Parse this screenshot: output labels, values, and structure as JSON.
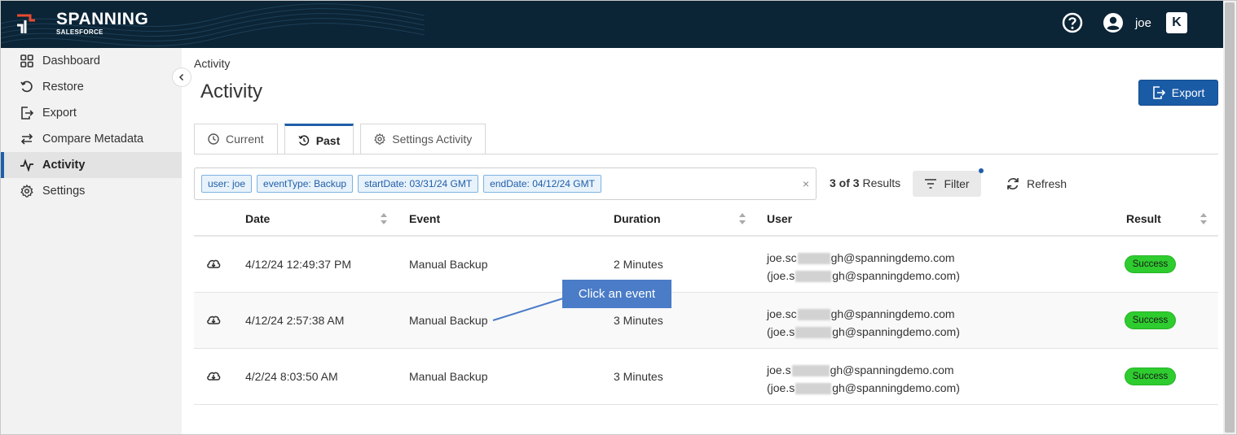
{
  "header": {
    "brand": "SPANNING",
    "brand_sub": "SALESFORCE",
    "user_name": "joe",
    "app_icon_letter": "K",
    "icons": [
      "help-icon",
      "user-avatar-icon"
    ]
  },
  "sidebar": {
    "items": [
      {
        "label": "Dashboard",
        "icon": "grid-icon"
      },
      {
        "label": "Restore",
        "icon": "restore-icon"
      },
      {
        "label": "Export",
        "icon": "export-icon"
      },
      {
        "label": "Compare Metadata",
        "icon": "compare-icon"
      },
      {
        "label": "Activity",
        "icon": "activity-icon",
        "active": true
      },
      {
        "label": "Settings",
        "icon": "gear-icon"
      }
    ]
  },
  "page": {
    "breadcrumb": "Activity",
    "title": "Activity",
    "export_label": "Export"
  },
  "tabs": [
    {
      "label": "Current",
      "icon": "clock-icon"
    },
    {
      "label": "Past",
      "icon": "history-icon",
      "active": true
    },
    {
      "label": "Settings Activity",
      "icon": "gear-icon"
    }
  ],
  "filters": {
    "chips": [
      "user: joe",
      "eventType: Backup",
      "startDate: 03/31/24 GMT",
      "endDate: 04/12/24 GMT"
    ],
    "clear": "×",
    "results_count": "3 of 3",
    "results_label": "Results",
    "filter_label": "Filter",
    "refresh_label": "Refresh"
  },
  "table": {
    "columns": [
      "Date",
      "Event",
      "Duration",
      "User",
      "Result"
    ],
    "rows": [
      {
        "date": "4/12/24 12:49:37 PM",
        "event": "Manual Backup",
        "duration": "2 Minutes",
        "user_a1": "joe.sc",
        "user_a2": "gh@spanningdemo.com",
        "user_b1": "(joe.s",
        "user_b2": "gh@spanningdemo.com)",
        "result": "Success"
      },
      {
        "date": "4/12/24 2:57:38 AM",
        "event": "Manual Backup",
        "duration": "3 Minutes",
        "user_a1": "joe.sc",
        "user_a2": "gh@spanningdemo.com",
        "user_b1": "(joe.s",
        "user_b2": "gh@spanningdemo.com)",
        "result": "Success"
      },
      {
        "date": "4/2/24 8:03:50 AM",
        "event": "Manual Backup",
        "duration": "3 Minutes",
        "user_a1": "joe.s",
        "user_a2": "gh@spanningdemo.com",
        "user_b1": "(joe.s",
        "user_b2": "gh@spanningdemo.com)",
        "result": "Success"
      }
    ]
  },
  "annotation": {
    "callout_text": "Click an event"
  },
  "colors": {
    "header_bg": "#0b2436",
    "accent": "#1f5ea8",
    "success": "#2ecc2e",
    "callout": "#4a7cc7"
  }
}
